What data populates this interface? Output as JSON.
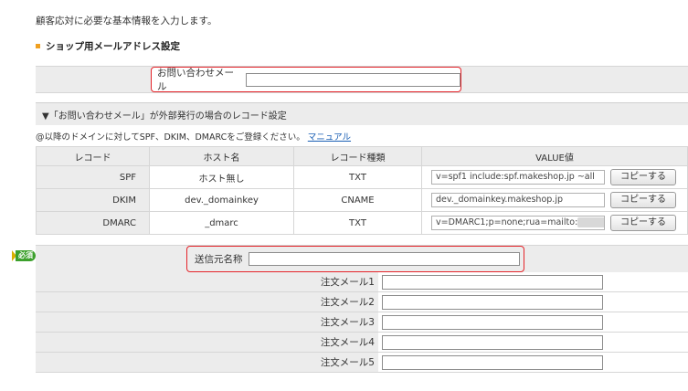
{
  "intro_text": "顧客応対に必要な基本情報を入力します。",
  "section_title": "ショップ用メールアドレス設定",
  "contact": {
    "label": "お問い合わせメール",
    "value": ""
  },
  "record": {
    "heading": "▼「お問い合わせメール」が外部発行の場合のレコード設定",
    "note": "@以降のドメインに対してSPF、DKIM、DMARCをご登録ください。",
    "manual_link": "マニュアル",
    "columns": [
      "レコード",
      "ホスト名",
      "レコード種類",
      "VALUE値"
    ],
    "rows": [
      {
        "record": "SPF",
        "host": "ホスト無し",
        "type": "TXT",
        "value": "v=spf1 include:spf.makeshop.jp ~all",
        "button": "コピーする"
      },
      {
        "record": "DKIM",
        "host": "dev._domainkey",
        "type": "CNAME",
        "value": "dev._domainkey.makeshop.jp",
        "button": "コピーする"
      },
      {
        "record": "DMARC",
        "host": "_dmarc",
        "type": "TXT",
        "value": "v=DMARC1;p=none;rua=mailto:",
        "button": "コピーする"
      }
    ]
  },
  "required_badge": "必須",
  "sender": {
    "label": "送信元名称",
    "value": ""
  },
  "order_mails": [
    {
      "label": "注文メール1",
      "value": ""
    },
    {
      "label": "注文メール2",
      "value": ""
    },
    {
      "label": "注文メール3",
      "value": ""
    },
    {
      "label": "注文メール4",
      "value": ""
    },
    {
      "label": "注文メール5",
      "value": ""
    }
  ],
  "colors": {
    "highlight_border": "#e5242a",
    "row_bg": "#ececec",
    "link": "#1a5fb4",
    "required_green": "#3ca02c"
  }
}
